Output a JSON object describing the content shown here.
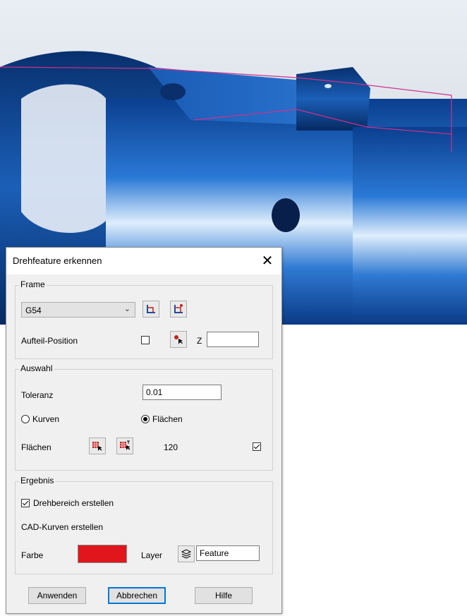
{
  "dialog": {
    "title": "Drehfeature erkennen",
    "close_glyph": "✕"
  },
  "frame": {
    "legend": "Frame",
    "select_value": "G54",
    "aufteil_label": "Aufteil-Position",
    "aufteil_checked": false,
    "z_label": "Z",
    "z_value": ""
  },
  "auswahl": {
    "legend": "Auswahl",
    "toleranz_label": "Toleranz",
    "toleranz_value": "0.01",
    "kurven_label": "Kurven",
    "flaechen_radio_label": "Flächen",
    "selected": "Flächen",
    "flaechen_label": "Flächen",
    "flaechen_count": "120",
    "flaechen_checked": true
  },
  "ergebnis": {
    "legend": "Ergebnis",
    "drehbereich_label": "Drehbereich erstellen",
    "drehbereich_checked": true,
    "cad_label": "CAD-Kurven erstellen",
    "farbe_label": "Farbe",
    "farbe_color": "#e0161c",
    "layer_label": "Layer",
    "layer_value": "Feature"
  },
  "buttons": {
    "apply": "Anwenden",
    "cancel": "Abbrechen",
    "help": "Hilfe"
  },
  "icons": [
    "frame-select-icon",
    "frame-edit-icon",
    "position-pick-icon",
    "face-select-icon",
    "face-select-alt-icon",
    "layer-icon"
  ],
  "colors": {
    "part_blue": "#1e64c8",
    "feature_line": "#d0308a"
  }
}
